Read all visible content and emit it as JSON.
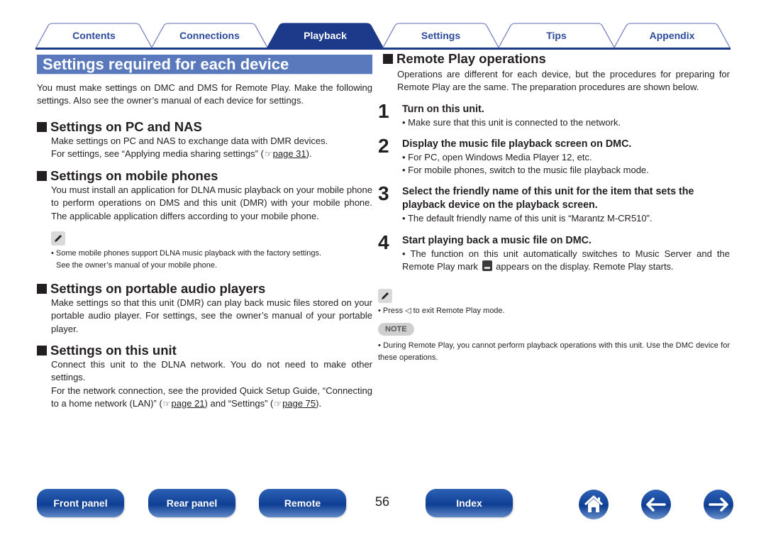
{
  "tabs": [
    {
      "label": "Contents",
      "active": false
    },
    {
      "label": "Connections",
      "active": false
    },
    {
      "label": "Playback",
      "active": true
    },
    {
      "label": "Settings",
      "active": false
    },
    {
      "label": "Tips",
      "active": false
    },
    {
      "label": "Appendix",
      "active": false
    }
  ],
  "colors": {
    "accent": "#1d3a8a",
    "title_bar": "#5a79bd",
    "tab_text": "#2b4a9a"
  },
  "left": {
    "title": "Settings required for each device",
    "intro": "You must make settings on DMC and DMS for Remote Play. Make the following settings. Also see the owner’s manual of each device for settings.",
    "pc": {
      "heading": "Settings on PC and NAS",
      "line1": "Make settings on PC and NAS to exchange data with DMR devices.",
      "line2_pre": "For settings, see “Applying media sharing settings” (",
      "line2_link": "page 31",
      "line2_post": ")."
    },
    "mobile": {
      "heading": "Settings on mobile phones",
      "body": "You must install an application for DLNA music playback on your mobile phone to perform operations on DMS and this unit (DMR) with your mobile phone. The applicable application differs according to your mobile phone.",
      "memo_line1": "• Some mobile phones support DLNA music playback with the factory settings.",
      "memo_line2": "See the owner’s manual of your mobile phone."
    },
    "portable": {
      "heading": "Settings on portable audio players",
      "body": "Make settings so that this unit (DMR) can play back music files stored on your portable audio player. For settings, see the owner’s manual of your portable player."
    },
    "unit": {
      "heading": "Settings on this unit",
      "body1": "Connect this unit to the DLNA network. You do not need to make other settings.",
      "body2_pre": "For the network connection, see the provided Quick Setup Guide, “Connecting to a home network (LAN)” (",
      "body2_link1": "page 21",
      "body2_mid": ") and “Settings” (",
      "body2_link2": "page 75",
      "body2_post": ")."
    }
  },
  "right": {
    "heading": "Remote Play operations",
    "intro": "Operations are different for each device, but the procedures for preparing for Remote Play are the same. The preparation procedures are shown below.",
    "steps": [
      {
        "num": "1",
        "title": "Turn on this unit.",
        "bullets": [
          "Make sure that this unit is connected to the network."
        ]
      },
      {
        "num": "2",
        "title": "Display the music file playback screen on DMC.",
        "bullets": [
          "For PC, open Windows Media Player 12, etc.",
          "For mobile phones, switch to the music file playback mode."
        ]
      },
      {
        "num": "3",
        "title": "Select the friendly name of this unit for the item that sets the playback device on the playback screen.",
        "bullets": [
          "The default friendly name of this unit is “Marantz M-CR510”."
        ]
      },
      {
        "num": "4",
        "title": "Start playing back a music file on DMC.",
        "bullet_pre": "The function on this unit automatically switches to Music Server and the Remote Play mark",
        "bullet_post": "appears on the display. Remote Play starts."
      }
    ],
    "memo": "• Press ◁ to exit Remote Play mode.",
    "note_label": "NOTE",
    "note": "• During Remote Play, you cannot perform playback operations with this unit. Use the DMC device for these operations."
  },
  "footer": {
    "buttons": [
      "Front panel",
      "Rear panel",
      "Remote",
      "Index"
    ],
    "page_number": "56",
    "icons": [
      "home-icon",
      "back-arrow-icon",
      "forward-arrow-icon"
    ]
  }
}
